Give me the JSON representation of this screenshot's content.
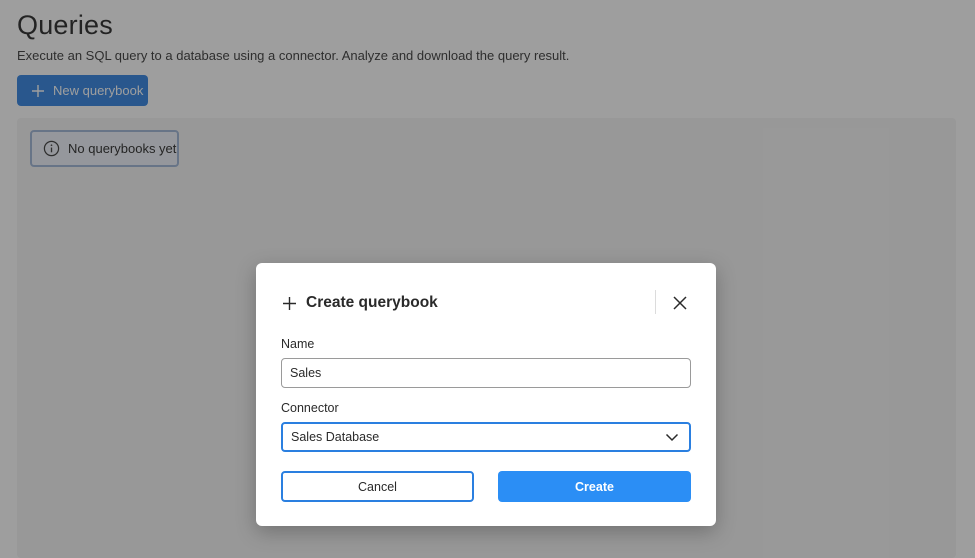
{
  "page": {
    "title": "Queries",
    "subtitle": "Execute an SQL query to a database using a connector. Analyze and download the query result.",
    "new_button_label": "New querybook",
    "empty_state": "No querybooks yet"
  },
  "modal": {
    "title": "Create querybook",
    "name_label": "Name",
    "name_value": "Sales",
    "connector_label": "Connector",
    "connector_value": "Sales Database",
    "cancel_label": "Cancel",
    "create_label": "Create"
  },
  "icons": {
    "title_icon": "plus-icon",
    "close_icon": "close-icon",
    "select_icon": "chevron-down-icon",
    "info_icon": "info-icon"
  },
  "colors": {
    "accent": "#2a7fe0",
    "create_button": "#2b8ef5",
    "overlay": "rgba(40,40,40,0.45)"
  }
}
